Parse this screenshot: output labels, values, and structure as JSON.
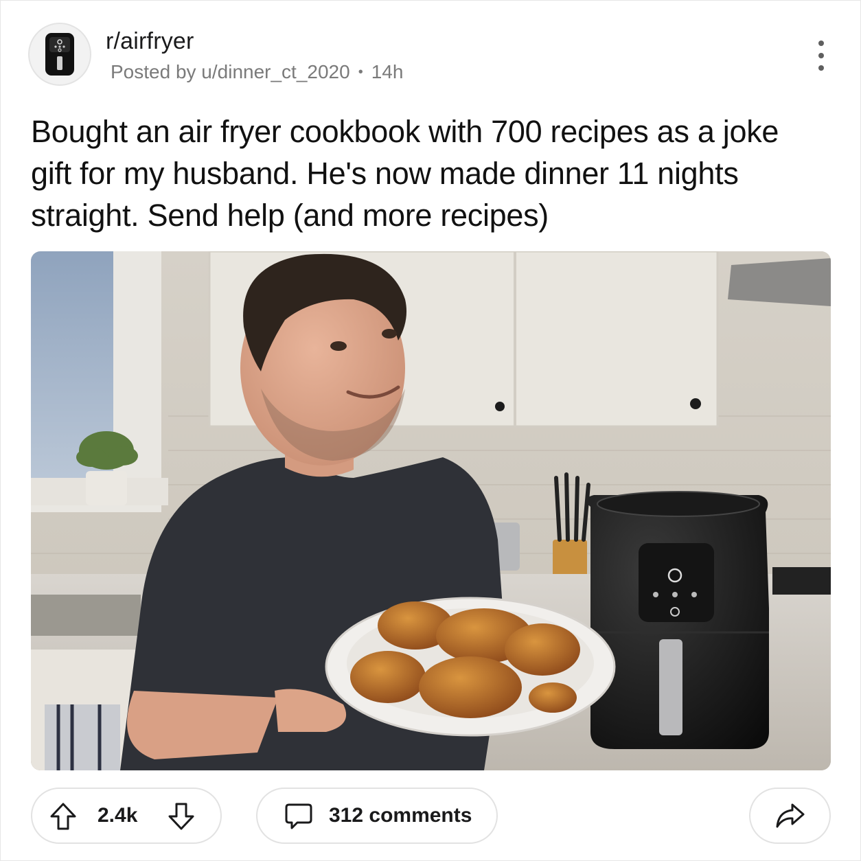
{
  "post": {
    "subreddit": "r/airfryer",
    "posted_by": "Posted by u/dinner_ct_2020",
    "age": "14h",
    "separator": "•",
    "title": "Bought an air fryer cookbook with 700 recipes as a joke gift for my husband. He's now made dinner 11 nights straight. Send help (and more recipes)"
  },
  "media": {
    "description_icon": "photo-of-man-holding-chicken-plate-next-to-air-fryer"
  },
  "actions": {
    "score": "2.4k",
    "comments_label": "312 comments"
  },
  "icons": {
    "avatar": "air-fryer-icon",
    "more": "more-vertical-icon",
    "upvote": "arrow-up-icon",
    "downvote": "arrow-down-icon",
    "comment": "comment-bubble-icon",
    "share": "share-arrow-icon"
  },
  "colors": {
    "text": "#1a1a1b",
    "muted": "#7a7a7a",
    "border": "#e2e2e2"
  }
}
